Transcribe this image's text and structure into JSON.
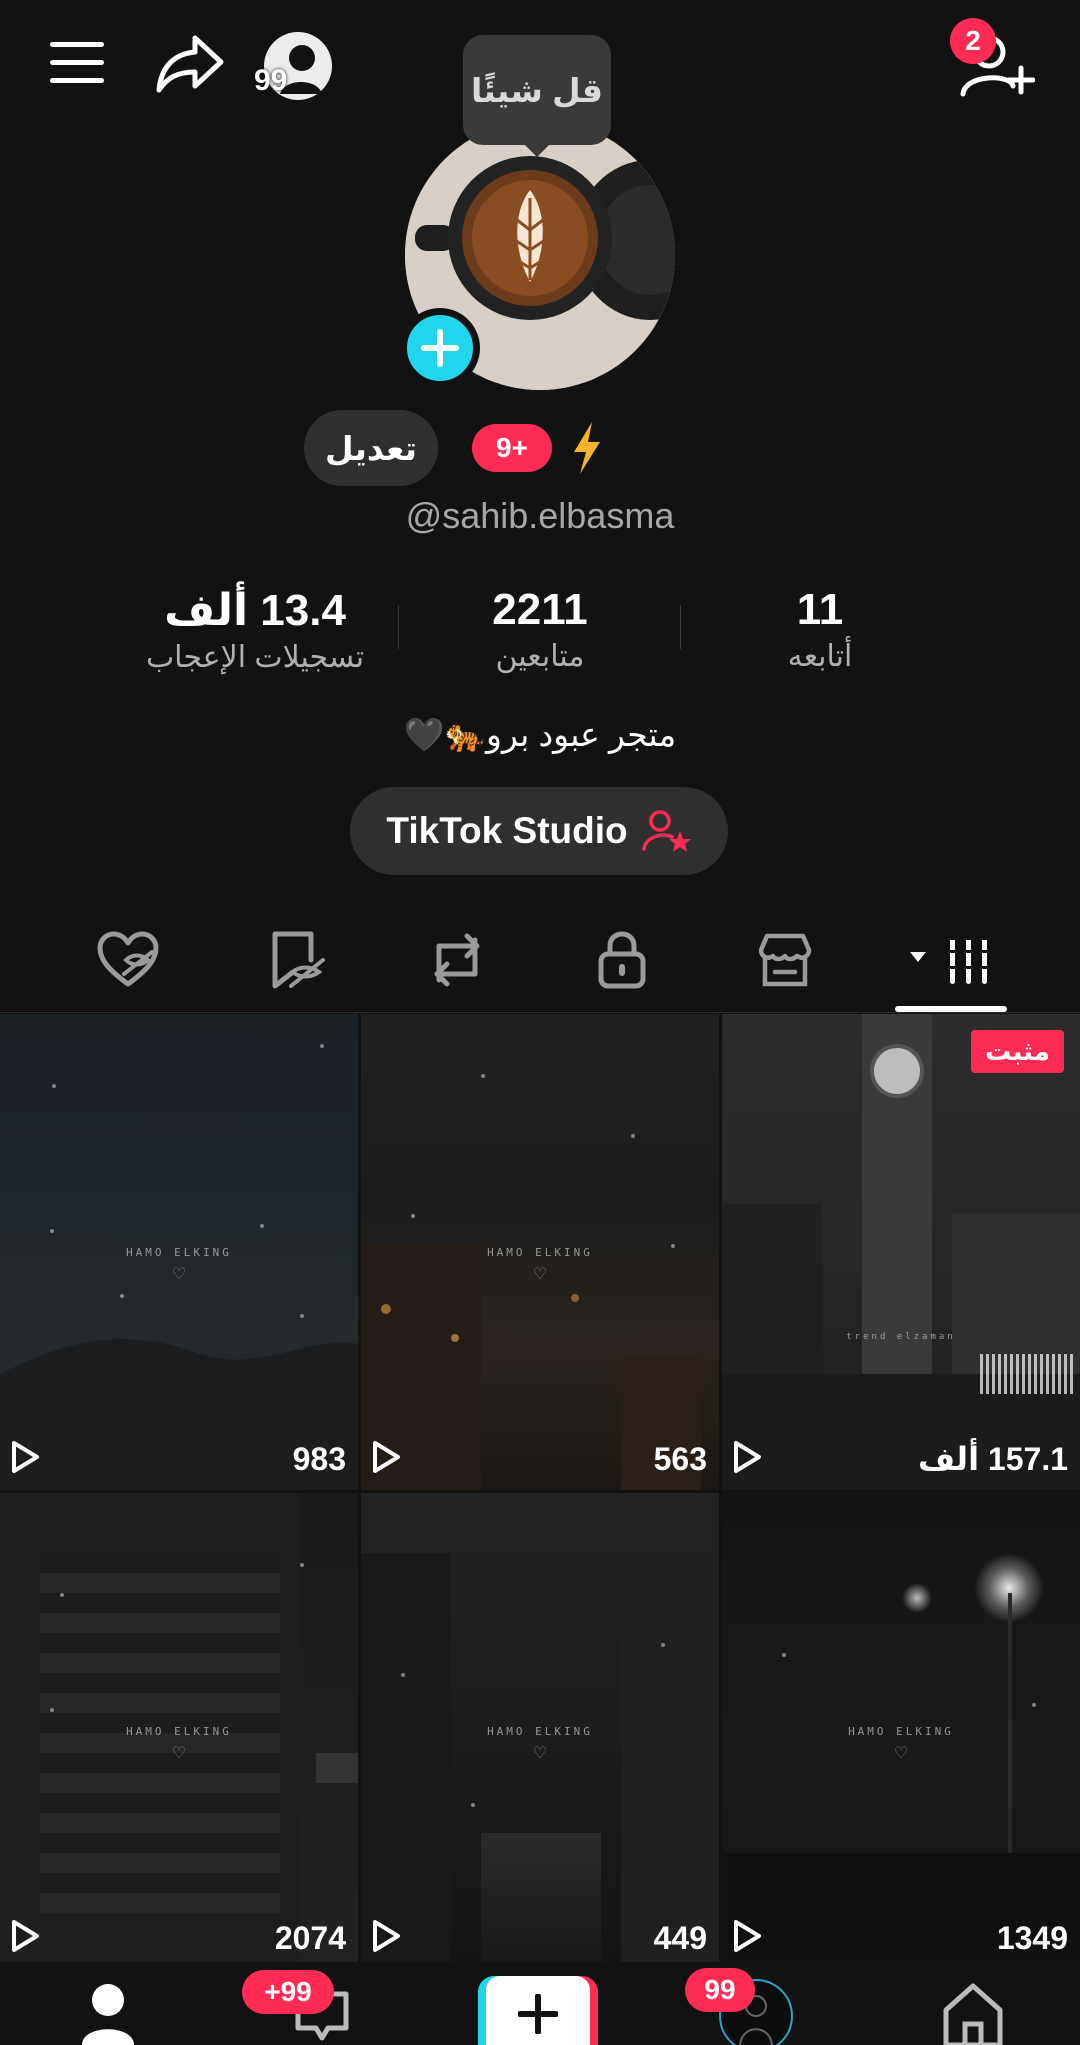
{
  "header": {
    "menu_icon": "hamburger-icon",
    "share_icon": "share-icon",
    "story_count": "99",
    "add_friend_badge": "2"
  },
  "profile": {
    "tooltip": "قل شيئًا",
    "edit_label": "تعديل",
    "badge": "9+",
    "handle": "@sahib.elbasma",
    "bio": "متجر عبود برو🐅🖤",
    "studio_label": "TikTok Studio"
  },
  "stats": [
    {
      "value": "13.4 ألف",
      "label": "تسجيلات الإعجاب"
    },
    {
      "value": "2211",
      "label": "متابعين"
    },
    {
      "value": "11",
      "label": "أتابعه"
    }
  ],
  "tabs": [
    {
      "icon": "liked-hidden-icon"
    },
    {
      "icon": "bookmark-hidden-icon"
    },
    {
      "icon": "repost-icon"
    },
    {
      "icon": "lock-icon"
    },
    {
      "icon": "shop-icon"
    },
    {
      "icon": "videos-grid-icon"
    }
  ],
  "videos": [
    {
      "views": "983",
      "watermark": "HAMO ELKING"
    },
    {
      "views": "563",
      "watermark": "HAMO ELKING"
    },
    {
      "views": "157.1 ألف",
      "pinned": "مثبت",
      "watermark": "trend elzaman"
    },
    {
      "views": "2074",
      "watermark": "HAMO ELKING"
    },
    {
      "views": "449",
      "watermark": "HAMO ELKING"
    },
    {
      "views": "1349",
      "watermark": "HAMO ELKING"
    }
  ],
  "bottom_nav": {
    "inbox_badge": "+99",
    "friends_badge": "99"
  },
  "colors": {
    "background": "#121212",
    "accent": "#fe2c55",
    "cyan": "#20d5ec"
  }
}
